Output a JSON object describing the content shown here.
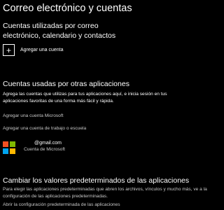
{
  "page": {
    "title": "Correo electrónico y cuentas"
  },
  "email_section": {
    "heading": "Cuentas utilizadas por correo electrónico, calendario y contactos",
    "add_account": {
      "icon": "plus-icon",
      "label": "Agregar una cuenta"
    }
  },
  "apps_section": {
    "heading": "Cuentas usadas por otras aplicaciones",
    "description": "Agrega las cuentas que utilizas para tus aplicaciones aquí, e inicia sesión en tus aplicaciones favoritas de una forma más fácil y rápida.",
    "links": {
      "add_microsoft": "Agregar una cuenta Microsoft",
      "add_work_school": "Agregar una cuenta de trabajo o escuela"
    },
    "account": {
      "icon": "microsoft-logo-icon",
      "email": "@gmail.com",
      "type": "Cuenta de Microsoft"
    }
  },
  "defaults_section": {
    "heading": "Cambiar los valores predeterminados de las aplicaciones",
    "description": "Para elegir las aplicaciones predeterminadas que abren los archivos, vínculos y mucho más, ve a la configuración de las aplicaciones predeterminadas.",
    "link": "Abrir la configuración predeterminada de las aplicaciones"
  },
  "colors": {
    "background": "#000000",
    "text": "#ffffff",
    "link": "#c8c8c8",
    "ms_red": "#f25022",
    "ms_green": "#7fba00",
    "ms_blue": "#00a4ef",
    "ms_yellow": "#ffb900"
  }
}
